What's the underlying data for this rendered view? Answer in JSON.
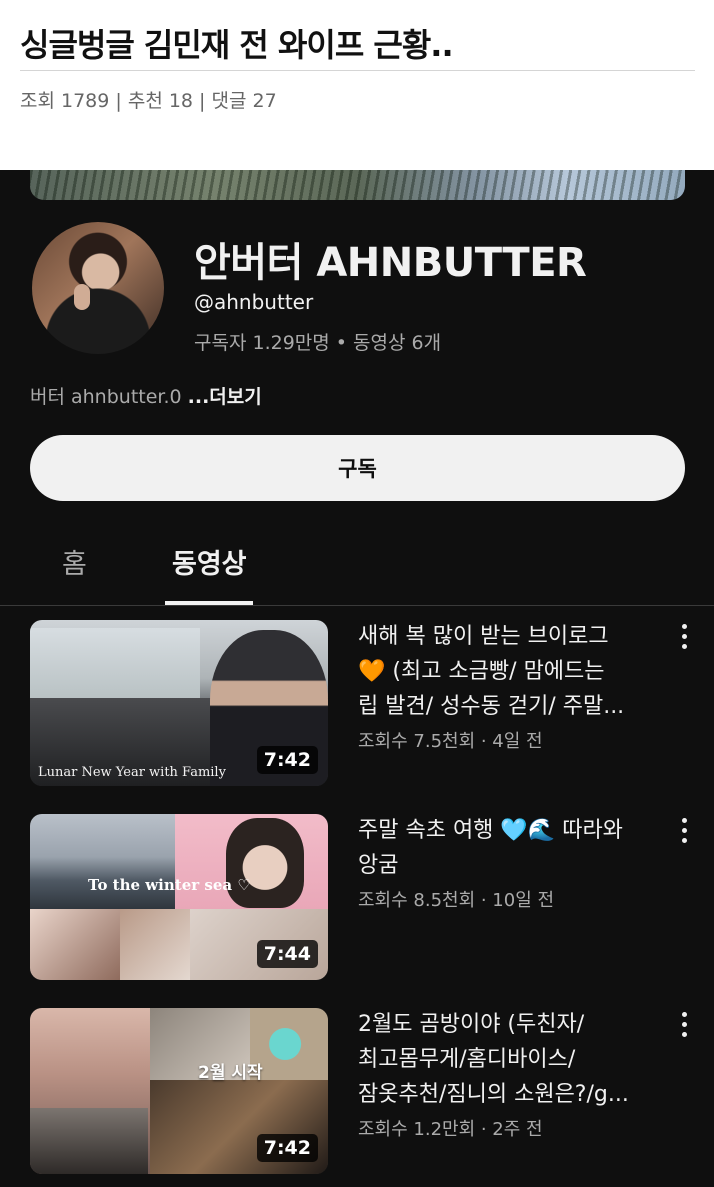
{
  "post": {
    "title": "싱글벙글 김민재 전 와이프 근황..",
    "meta": "조회 1789 | 추천 18 | 댓글 27"
  },
  "channel": {
    "name": "안버터 AHNBUTTER",
    "handle": "@ahnbutter",
    "stats": "구독자 1.29만명 • 동영상 6개",
    "description": "버터 ahnbutter.0 ",
    "more_label": "...더보기",
    "subscribe_label": "구독"
  },
  "tabs": [
    {
      "label": "홈",
      "active": false
    },
    {
      "label": "동영상",
      "active": true
    }
  ],
  "videos": [
    {
      "title_lines": [
        "새해 복 많이 받는 브이로그",
        "🧡 (최고 소금빵/ 맘에드는",
        "립 발견/ 성수동 걷기/ 주말..."
      ],
      "meta": "조회수 7.5천회 · 4일 전",
      "duration": "7:42",
      "thumb_caption": "Lunar New Year with Family"
    },
    {
      "title_lines": [
        "주말 속초 여행 🩵🌊 따라와",
        "앙굼"
      ],
      "meta": "조회수 8.5천회 · 10일 전",
      "duration": "7:44",
      "thumb_caption": "To the winter sea ♡"
    },
    {
      "title_lines": [
        "2월도 곰방이야 (두친자/",
        "최고몸무게/홈디바이스/",
        "잠옷추천/짐니의 소원은?/g..."
      ],
      "meta": "조회수 1.2만회 · 2주 전",
      "duration": "7:42",
      "thumb_caption": "2월 시작"
    }
  ],
  "colors": {
    "dark_bg": "#0f0f0f",
    "text_primary": "#f1f1f1",
    "text_secondary": "#aaaaaa",
    "subscribe_bg": "#f1f1f1"
  },
  "icons": [
    "more-vert-icon"
  ]
}
